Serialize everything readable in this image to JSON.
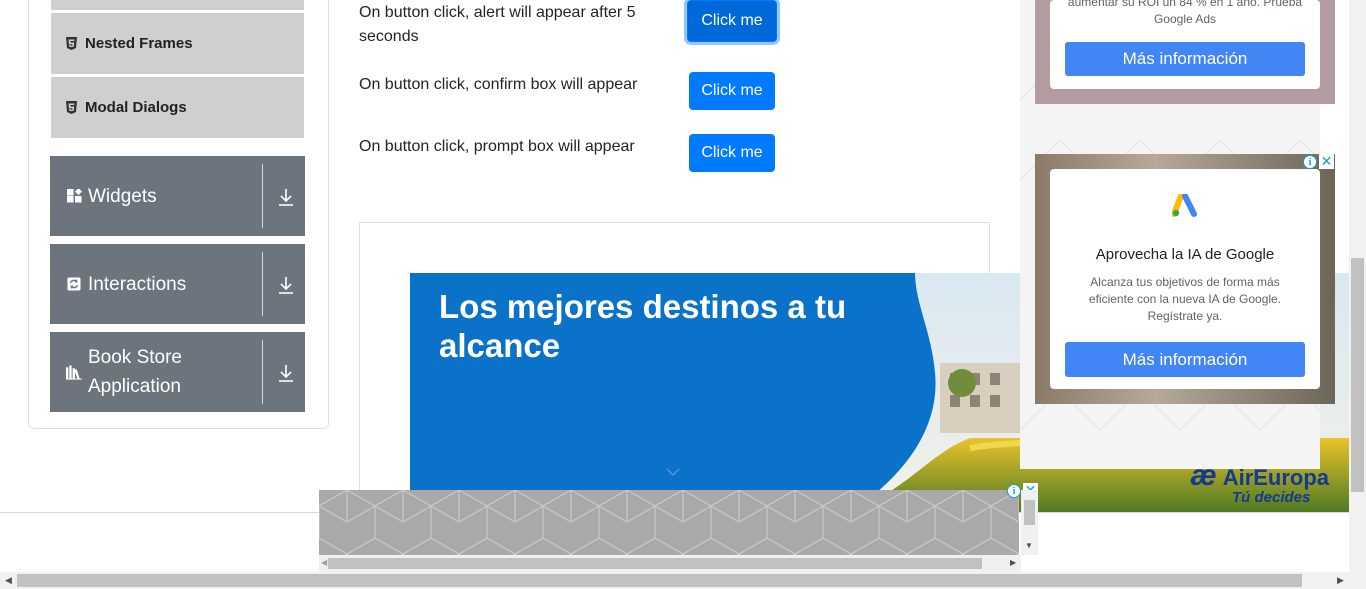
{
  "sidebar": {
    "sub_items": [
      {
        "label": "Nested Frames",
        "icon": "html5-icon"
      },
      {
        "label": "Modal Dialogs",
        "icon": "html5-icon"
      }
    ],
    "groups": [
      {
        "label": "Widgets",
        "icon": "widgets-icon"
      },
      {
        "label": "Interactions",
        "icon": "interactions-icon"
      },
      {
        "label": "Book Store Application",
        "icon": "book-store-icon"
      }
    ]
  },
  "main": {
    "rows": [
      {
        "text": "On button click, alert will appear after 5 seconds",
        "button": "Click me"
      },
      {
        "text": "On button click, confirm box will appear",
        "button": "Click me"
      },
      {
        "text": "On button click, prompt box will appear",
        "button": "Click me"
      }
    ]
  },
  "banner_ad": {
    "headline": "Los mejores destinos a tu alcance",
    "brand": "AirEuropa",
    "tagline": "Tú decides",
    "brand_color": "#123a8e",
    "bg_color": "#0a72c8"
  },
  "right_ads": [
    {
      "body": "aumentar su ROI un 84 % en 1 año. Prueba Google Ads",
      "button": "Más información"
    },
    {
      "title": "Aprovecha la IA de Google",
      "body": "Alcanza tus objetivos de forma más eficiente con la nueva IA de Google. Regístrate ya.",
      "button": "Más información"
    }
  ],
  "colors": {
    "primary": "#007bff",
    "sidebar_group": "#6c757d",
    "sidebar_sub": "#cfcfcf",
    "ad_button": "#4285f4"
  }
}
